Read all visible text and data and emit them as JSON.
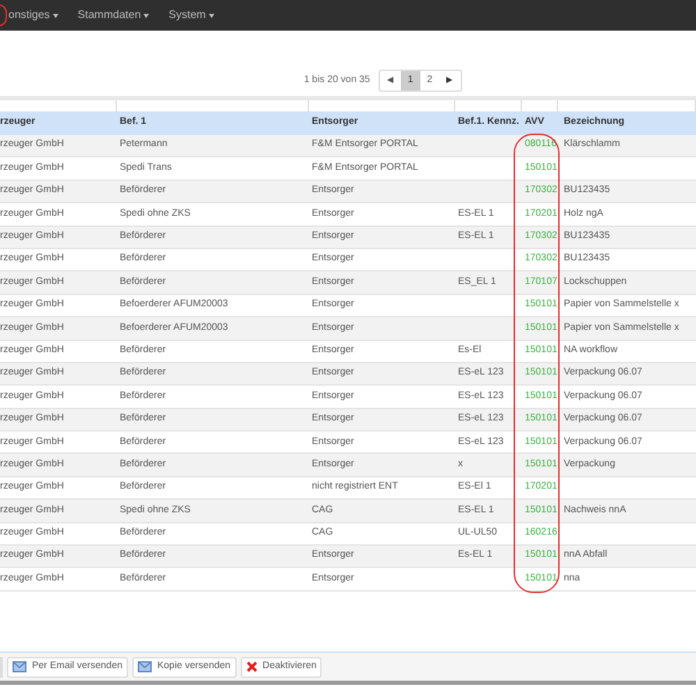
{
  "navbar": {
    "items": [
      {
        "label": "onstiges"
      },
      {
        "label": "Stammdaten"
      },
      {
        "label": "System"
      }
    ]
  },
  "pagination": {
    "summary": "1 bis 20 von 35",
    "prev": "◀",
    "next": "▶",
    "pages": [
      {
        "label": "1",
        "selected": true
      },
      {
        "label": "2",
        "selected": false
      }
    ]
  },
  "table": {
    "columns": [
      "rzeuger",
      "Bef. 1",
      "Entsorger",
      "Bef.1. Kennz.",
      "AVV",
      "Bezeichnung"
    ],
    "rows": [
      [
        "rzeuger GmbH",
        "Petermann",
        "F&M Entsorger PORTAL",
        "",
        "080116",
        "Klärschlamm"
      ],
      [
        "rzeuger GmbH",
        "Spedi Trans",
        "F&M Entsorger PORTAL",
        "",
        "150101",
        ""
      ],
      [
        "rzeuger GmbH",
        "Beförderer",
        "Entsorger",
        "",
        "170302",
        "BU123435"
      ],
      [
        "rzeuger GmbH",
        "Spedi ohne ZKS",
        "Entsorger",
        "ES-EL 1",
        "170201",
        "Holz ngA"
      ],
      [
        "rzeuger GmbH",
        "Beförderer",
        "Entsorger",
        "ES-EL 1",
        "170302",
        "BU123435"
      ],
      [
        "rzeuger GmbH",
        "Beförderer",
        "Entsorger",
        "",
        "170302",
        "BU123435"
      ],
      [
        "rzeuger GmbH",
        "Beförderer",
        "Entsorger",
        "ES_EL 1",
        "170107",
        "Lockschuppen"
      ],
      [
        "rzeuger GmbH",
        "Befoerderer AFUM20003",
        "Entsorger",
        "",
        "150101",
        "Papier von Sammelstelle x"
      ],
      [
        "rzeuger GmbH",
        "Befoerderer AFUM20003",
        "Entsorger",
        "",
        "150101",
        "Papier von Sammelstelle x"
      ],
      [
        "rzeuger GmbH",
        "Beförderer",
        "Entsorger",
        "Es-El",
        "150101",
        "NA workflow"
      ],
      [
        "rzeuger GmbH",
        "Beförderer",
        "Entsorger",
        "ES-eL 123",
        "150101",
        "Verpackung 06.07"
      ],
      [
        "rzeuger GmbH",
        "Beförderer",
        "Entsorger",
        "ES-eL 123",
        "150101",
        "Verpackung 06.07"
      ],
      [
        "rzeuger GmbH",
        "Beförderer",
        "Entsorger",
        "ES-eL 123",
        "150101",
        "Verpackung 06.07"
      ],
      [
        "rzeuger GmbH",
        "Beförderer",
        "Entsorger",
        "ES-eL 123",
        "150101",
        "Verpackung 06.07"
      ],
      [
        "rzeuger GmbH",
        "Beförderer",
        "Entsorger",
        "x",
        "150101",
        "Verpackung"
      ],
      [
        "rzeuger GmbH",
        "Beförderer",
        "nicht registriert ENT",
        "ES-El 1",
        "170201",
        ""
      ],
      [
        "rzeuger GmbH",
        "Spedi ohne ZKS",
        "CAG",
        "ES-EL 1",
        "150101",
        "Nachweis nnA"
      ],
      [
        "rzeuger GmbH",
        "Beförderer",
        "CAG",
        "UL-UL50",
        "160216",
        ""
      ],
      [
        "rzeuger GmbH",
        "Beförderer",
        "Entsorger",
        "Es-EL 1",
        "150101",
        "nnA Abfall"
      ],
      [
        "rzeuger GmbH",
        "Beförderer",
        "Entsorger",
        "",
        "150101",
        "nna"
      ]
    ]
  },
  "actions": [
    {
      "kind": "mail",
      "label": "Per Email versenden"
    },
    {
      "kind": "mail",
      "label": "Kopie versenden"
    },
    {
      "kind": "delete",
      "label": "Deaktivieren"
    }
  ]
}
